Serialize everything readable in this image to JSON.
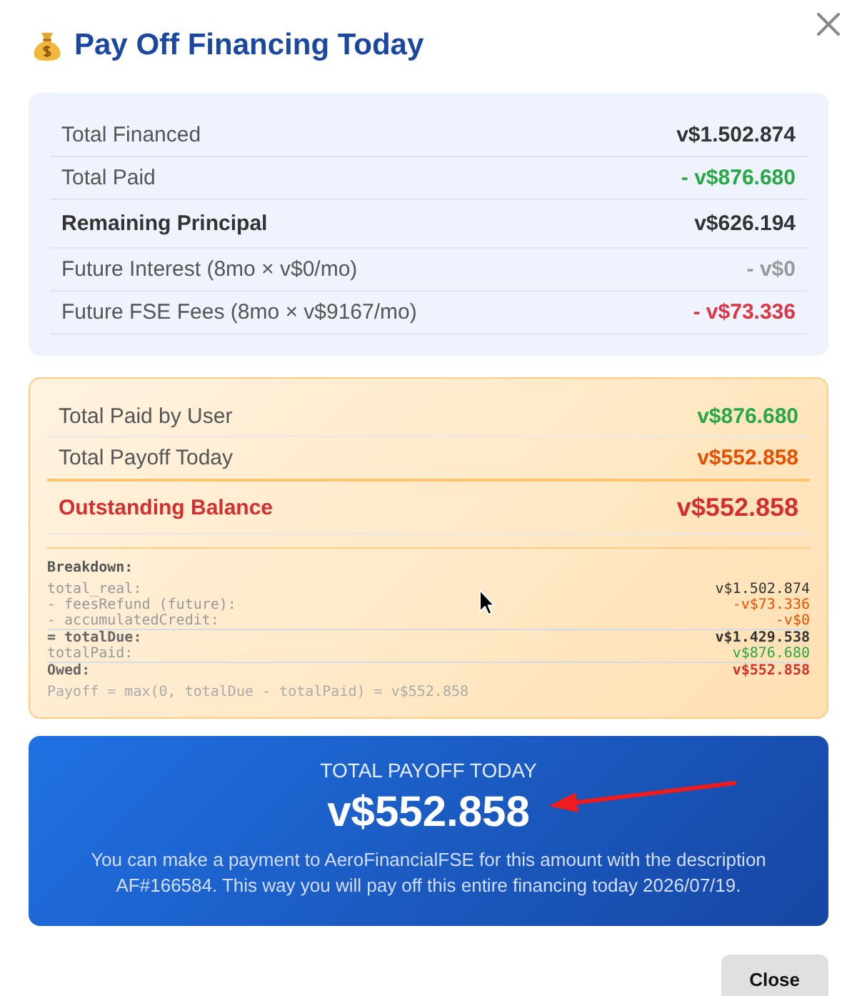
{
  "dialog": {
    "title": "Pay Off Financing Today"
  },
  "summary": {
    "rows": [
      {
        "kind": "line",
        "label": "Total Financed",
        "value": "v$1.502.874",
        "color": "#333333"
      },
      {
        "kind": "line",
        "label": "Total Paid",
        "value": "- v$876.680",
        "color": "#28a745"
      },
      {
        "kind": "total",
        "label": "Remaining Principal",
        "value": "v$626.194",
        "color": "#333333"
      },
      {
        "kind": "line",
        "label": "Future Interest (8mo × v$0/mo)",
        "value": "- v$0",
        "color": "#999999"
      },
      {
        "kind": "line",
        "label": "Future FSE Fees (8mo × v$9167/mo)",
        "value": "- v$73.336",
        "color": "#dc3545"
      }
    ]
  },
  "balance": {
    "rows": [
      {
        "kind": "line",
        "label": "Total Paid by User",
        "value": "v$876.680",
        "color": "#28a745"
      },
      {
        "kind": "line",
        "label": "Total Payoff Today",
        "value": "v$552.858",
        "color": "#e65100"
      },
      {
        "kind": "total",
        "label": "Outstanding Balance",
        "value": "v$552.858",
        "color": "#d32f2f"
      }
    ],
    "breakdown": {
      "heading": "Breakdown:",
      "rows": [
        {
          "kind": "line",
          "label": "total_real:",
          "value": "v$1.502.874",
          "color": "#333333"
        },
        {
          "kind": "line",
          "label": "- feesRefund (future):",
          "value": "-v$73.336",
          "color": "#e65100"
        },
        {
          "kind": "line",
          "label": "- accumulatedCredit:",
          "value": "-v$0",
          "color": "#e65100"
        },
        {
          "kind": "total",
          "label": "= totalDue:",
          "value": "v$1.429.538",
          "color": "#333333"
        },
        {
          "kind": "line",
          "label": "totalPaid:",
          "value": "v$876.680",
          "color": "#28a745"
        },
        {
          "kind": "total",
          "label": "Owed:",
          "value": "v$552.858",
          "color": "#d32f2f"
        }
      ],
      "formula": "Payoff = max(0, totalDue - totalPaid) = v$552.858"
    }
  },
  "payoff": {
    "caption": "TOTAL PAYOFF TODAY",
    "amount": "v$552.858",
    "note": "You can make a payment to AeroFinancialFSE for this amount with the description AF#166584. This way you will pay off this entire financing today 2026/07/19."
  },
  "buttons": [
    {
      "label": "Close"
    }
  ]
}
